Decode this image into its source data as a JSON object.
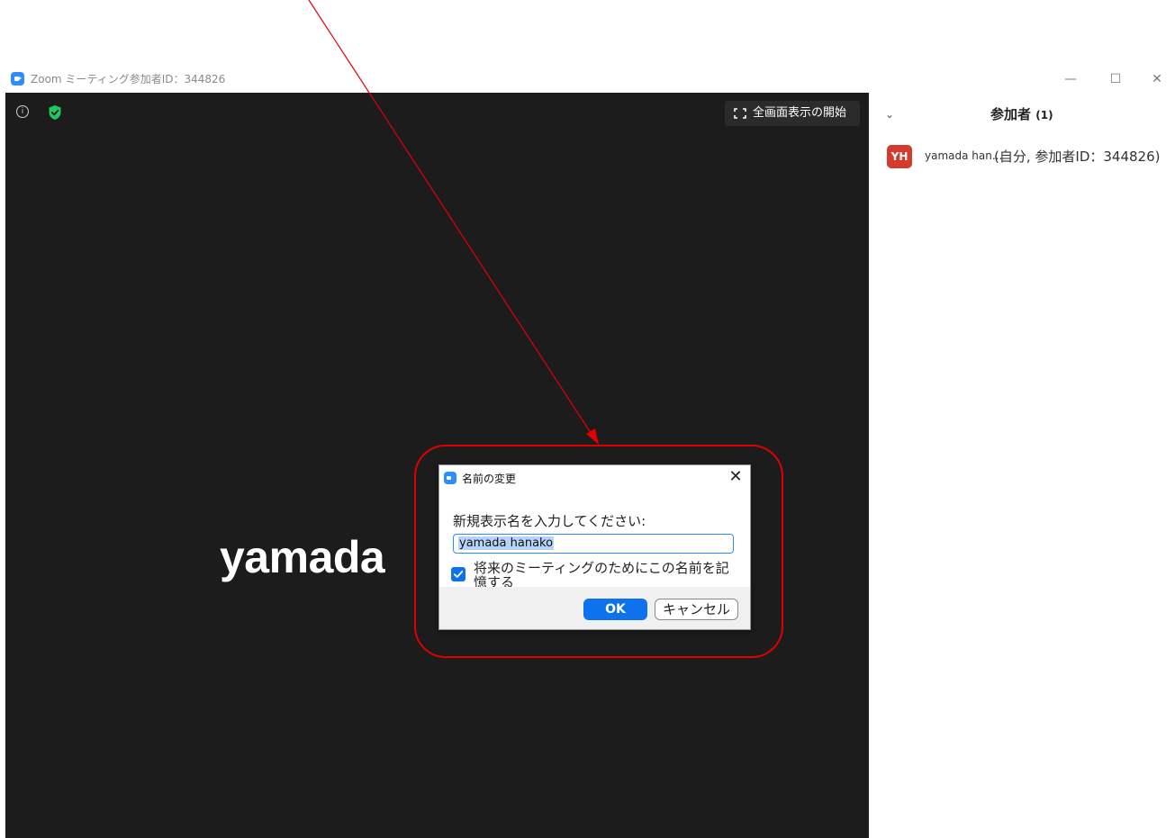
{
  "window": {
    "title": "Zoom ミーティング参加者ID：344826",
    "minimize_label": "—",
    "maximize_label": "☐",
    "close_label": "✕"
  },
  "video": {
    "info_icon_label": "i",
    "fullscreen_label": "全画面表示の開始",
    "participant_display_name": "yamada"
  },
  "participants_panel": {
    "chevron": "⌄",
    "title": "参加者",
    "count": "(1)",
    "participants": [
      {
        "initials": "YH",
        "avatar_color": "#d33b2c",
        "name": "yamada han...",
        "suffix": "(自分, 参加者ID：344826)"
      }
    ]
  },
  "dialog": {
    "title": "名前の変更",
    "close_label": "✕",
    "prompt": "新規表示名を入力してください:",
    "input_value": "yamada hanako",
    "remember_checked": true,
    "remember_label": "将来のミーティングのためにこの名前を記憶する",
    "ok_label": "OK",
    "cancel_label": "キャンセル"
  },
  "colors": {
    "zoom_blue": "#2D8CFF",
    "accent_blue": "#0e72ed",
    "annotation_red": "#e00000",
    "video_background": "#1c1c1c",
    "shield_green": "#1ec85a"
  },
  "icons": {
    "app": "zoom-app-icon",
    "info": "info-icon",
    "security": "shield-check-icon",
    "fullscreen": "fullscreen-icon",
    "checkbox": "checkmark-icon"
  }
}
